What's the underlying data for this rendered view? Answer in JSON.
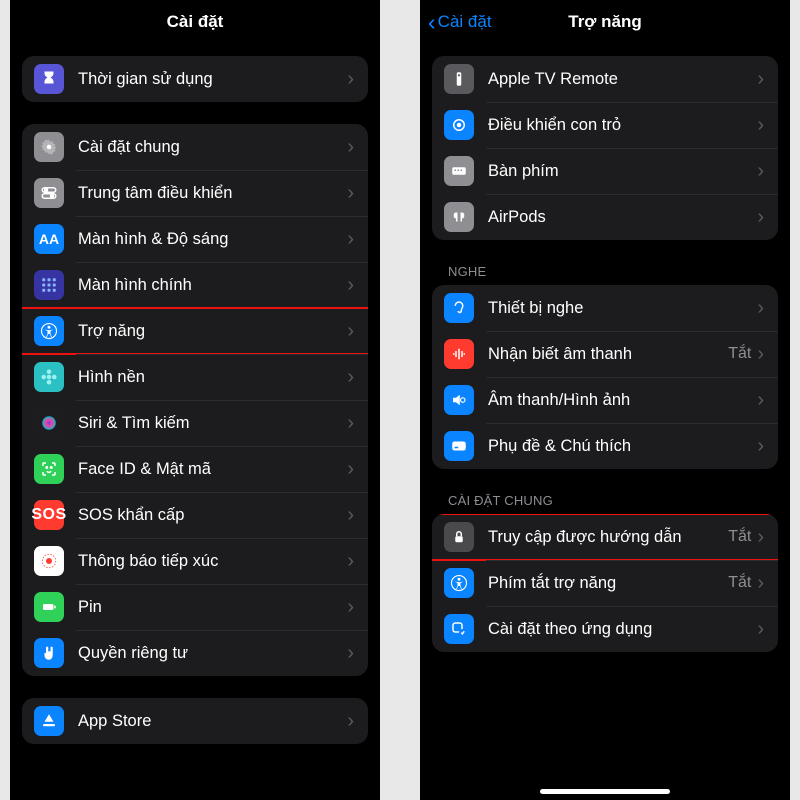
{
  "left": {
    "title": "Cài đặt",
    "groups": {
      "screentime": {
        "label": "Thời gian sử dụng"
      },
      "general": [
        {
          "key": "general",
          "label": "Cài đặt chung"
        },
        {
          "key": "control",
          "label": "Trung tâm điều khiển"
        },
        {
          "key": "display",
          "label": "Màn hình & Độ sáng"
        },
        {
          "key": "home",
          "label": "Màn hình chính"
        },
        {
          "key": "access",
          "label": "Trợ năng"
        },
        {
          "key": "wallpaper",
          "label": "Hình nền"
        },
        {
          "key": "siri",
          "label": "Siri & Tìm kiếm"
        },
        {
          "key": "faceid",
          "label": "Face ID & Mật mã"
        },
        {
          "key": "sos",
          "label": "SOS khẩn cấp"
        },
        {
          "key": "exposure",
          "label": "Thông báo tiếp xúc"
        },
        {
          "key": "battery",
          "label": "Pin"
        },
        {
          "key": "privacy",
          "label": "Quyền riêng tư"
        }
      ],
      "appstore": {
        "label": "App Store"
      }
    }
  },
  "right": {
    "back": "Cài đặt",
    "title": "Trợ năng",
    "top": [
      {
        "key": "remote",
        "label": "Apple TV Remote"
      },
      {
        "key": "pointer",
        "label": "Điều khiển con trỏ"
      },
      {
        "key": "keyboard",
        "label": "Bàn phím"
      },
      {
        "key": "airpods",
        "label": "AirPods"
      }
    ],
    "hear_header": "NGHE",
    "hear": [
      {
        "key": "hearing",
        "label": "Thiết bị nghe",
        "value": ""
      },
      {
        "key": "sound",
        "label": "Nhận biết âm thanh",
        "value": "Tắt"
      },
      {
        "key": "audiovisual",
        "label": "Âm thanh/Hình ảnh",
        "value": ""
      },
      {
        "key": "subtitle",
        "label": "Phụ đề & Chú thích",
        "value": ""
      }
    ],
    "general_header": "CÀI ĐẶT CHUNG",
    "general": [
      {
        "key": "guided",
        "label": "Truy cập được hướng dẫn",
        "value": "Tắt"
      },
      {
        "key": "shortcut",
        "label": "Phím tắt trợ năng",
        "value": "Tắt"
      },
      {
        "key": "perapp",
        "label": "Cài đặt theo ứng dụng",
        "value": ""
      }
    ]
  }
}
